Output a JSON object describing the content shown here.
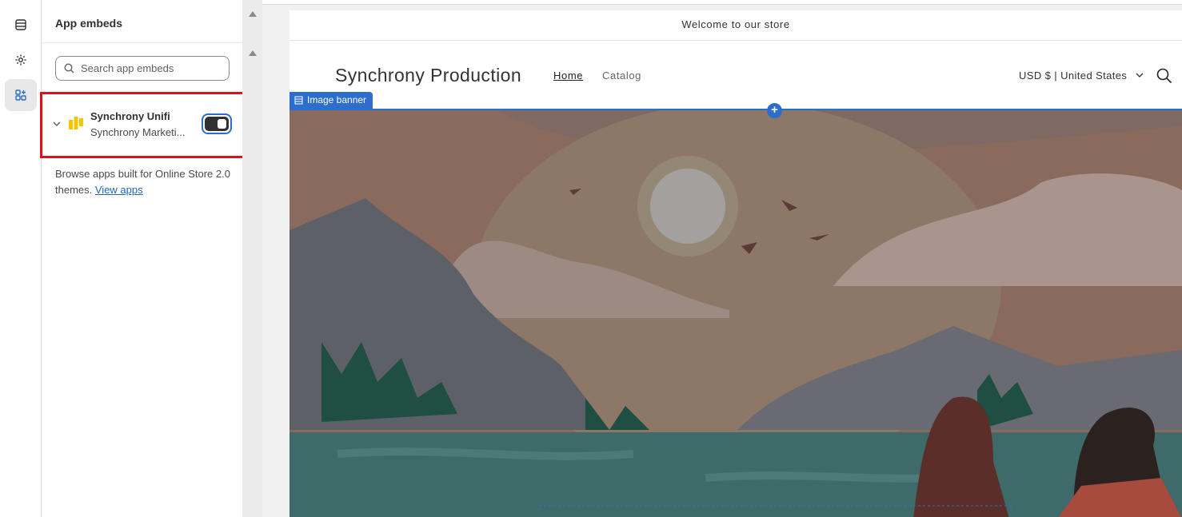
{
  "panel": {
    "title": "App embeds",
    "search_placeholder": "Search app embeds",
    "embed": {
      "name": "Synchrony Unifi",
      "subtitle": "Synchrony Marketi...",
      "enabled": true
    },
    "browse_text": "Browse apps built for Online Store 2.0 themes.",
    "browse_link": "View apps"
  },
  "preview": {
    "announcement": "Welcome to our store",
    "store_name": "Synchrony Production",
    "nav": [
      "Home",
      "Catalog"
    ],
    "currency": "USD $ | United States",
    "section_tag": "Image banner"
  },
  "colors": {
    "accent": "#2c6ecb",
    "highlight": "#d9131b"
  }
}
